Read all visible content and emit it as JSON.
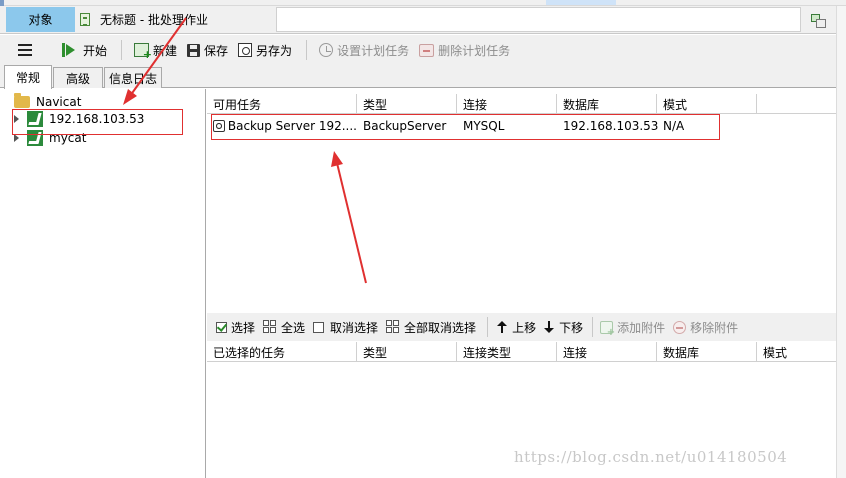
{
  "window_tabs": {
    "objects_tab": "对象",
    "document_tab": "无标题 - 批处理作业"
  },
  "toolbar": {
    "start": "开始",
    "new": "新建",
    "save": "保存",
    "save_as": "另存为",
    "set_schedule": "设置计划任务",
    "delete_schedule": "删除计划任务"
  },
  "sub_tabs": [
    "常规",
    "高级",
    "信息日志"
  ],
  "tree": {
    "root": "Navicat",
    "items": [
      "192.168.103.53",
      "mycat"
    ]
  },
  "available_tasks": {
    "columns": [
      "可用任务",
      "类型",
      "连接",
      "数据库",
      "模式"
    ],
    "rows": [
      {
        "task": "Backup Server 192....",
        "type": "BackupServer",
        "connection": "MYSQL",
        "database": "192.168.103.53",
        "schema": "N/A"
      }
    ]
  },
  "task_toolbar": {
    "select": "选择",
    "select_all": "全选",
    "deselect": "取消选择",
    "deselect_all": "全部取消选择",
    "move_up": "上移",
    "move_down": "下移",
    "add_attachment": "添加附件",
    "remove_attachment": "移除附件"
  },
  "selected_tasks": {
    "columns": [
      "已选择的任务",
      "类型",
      "连接类型",
      "连接",
      "数据库",
      "模式"
    ]
  },
  "watermark": "https://blog.csdn.net/u014180504",
  "colors": {
    "active_tab": "#8cc8ec",
    "annotation_red": "#e03030",
    "connection_green": "#2c8a3c"
  }
}
